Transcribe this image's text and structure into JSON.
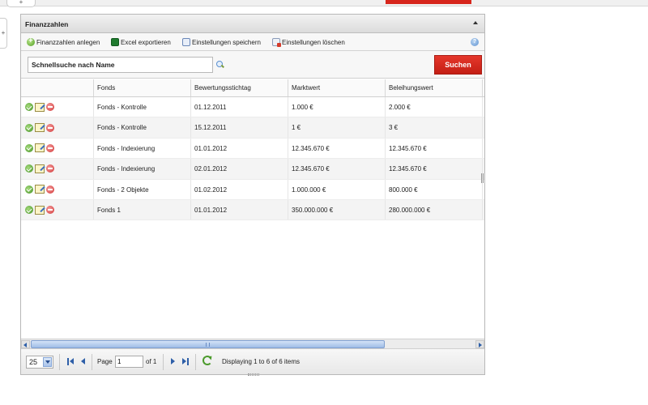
{
  "top": {
    "tab_symbol": "+",
    "side_symbol": "+"
  },
  "panel": {
    "title": "Finanzzahlen"
  },
  "toolbar": {
    "add_label": "Finanzzahlen anlegen",
    "export_label": "Excel exportieren",
    "save_label": "Einstellungen speichern",
    "delete_label": "Einstellungen löschen",
    "help_symbol": "?"
  },
  "search": {
    "value": "Schnellsuche nach Name",
    "button_label": "Suchen"
  },
  "grid": {
    "columns": [
      "",
      "Fonds",
      "Bewertungsstichtag",
      "Marktwert",
      "Beleihungswert"
    ],
    "rows": [
      [
        "Fonds - Kontrolle",
        "01.12.2011",
        "1.000 €",
        "2.000 €"
      ],
      [
        "Fonds - Kontrolle",
        "15.12.2011",
        "1 €",
        "3 €"
      ],
      [
        "Fonds - Indexierung",
        "01.01.2012",
        "12.345.670 €",
        "12.345.670 €"
      ],
      [
        "Fonds - Indexierung",
        "02.01.2012",
        "12.345.670 €",
        "12.345.670 €"
      ],
      [
        "Fonds - 2 Objekte",
        "01.02.2012",
        "1.000.000 €",
        "800.000 €"
      ],
      [
        "Fonds 1",
        "01.01.2012",
        "350.000.000 €",
        "280.000.000 €"
      ]
    ]
  },
  "pager": {
    "page_size": "25",
    "page_label": "Page",
    "page_value": "1",
    "of_label": "of 1",
    "display_text": "Displaying 1 to 6 of 6 items"
  },
  "colors": {
    "accent_red": "#d7261c",
    "link_blue": "#2e5fa8"
  }
}
